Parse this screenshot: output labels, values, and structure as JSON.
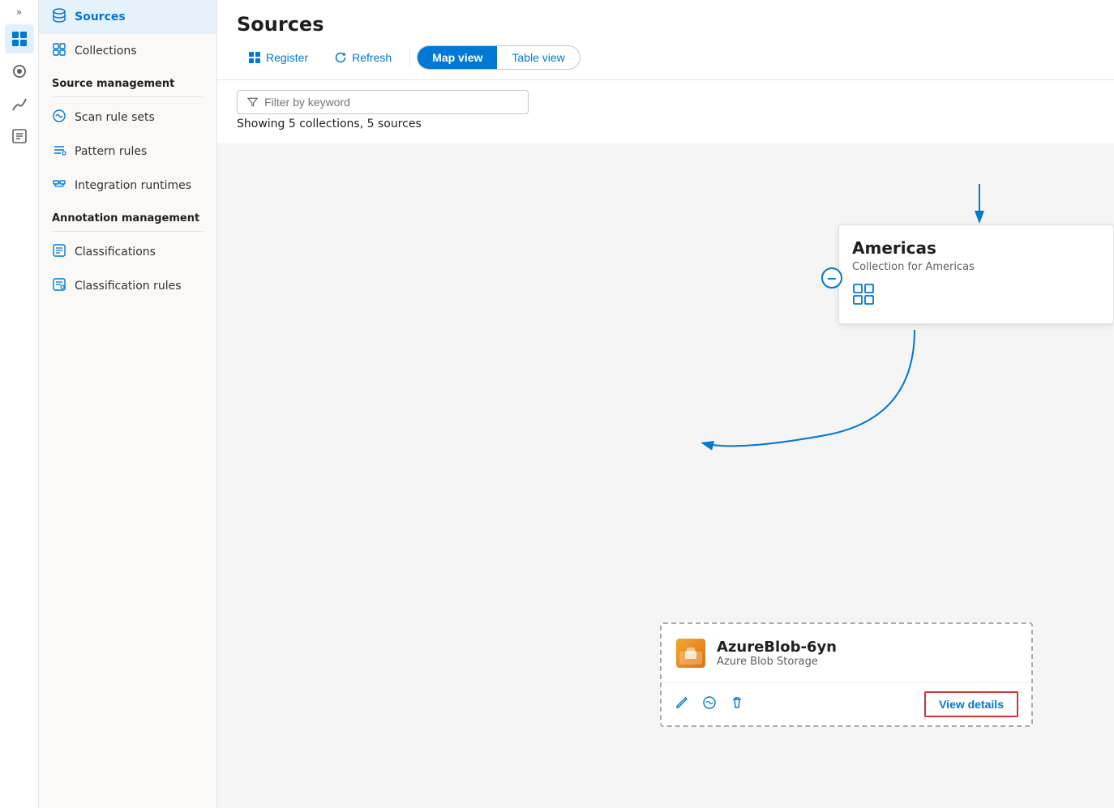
{
  "iconRail": {
    "chevron": "»",
    "icons": [
      {
        "name": "catalog-icon",
        "symbol": "🗄",
        "active": true
      },
      {
        "name": "manage-icon",
        "symbol": "⚙",
        "active": false
      },
      {
        "name": "insights-icon",
        "symbol": "📊",
        "active": false
      },
      {
        "name": "tools-icon",
        "symbol": "🧰",
        "active": false
      }
    ]
  },
  "sidebar": {
    "sourceItem": "Sources",
    "collectionsItem": "Collections",
    "sourceManagementLabel": "Source management",
    "scanRuleSets": "Scan rule sets",
    "patternRules": "Pattern rules",
    "integrationRuntimes": "Integration runtimes",
    "annotationManagementLabel": "Annotation management",
    "classifications": "Classifications",
    "classificationRules": "Classification rules"
  },
  "main": {
    "title": "Sources",
    "toolbar": {
      "registerLabel": "Register",
      "refreshLabel": "Refresh",
      "mapViewLabel": "Map view",
      "tableViewLabel": "Table view"
    },
    "filter": {
      "placeholder": "Filter by keyword"
    },
    "showingText": "Showing 5 collections, 5 sources"
  },
  "mapView": {
    "collection": {
      "title": "Americas",
      "subtitle": "Collection for Americas"
    },
    "source": {
      "name": "AzureBlob-6yn",
      "type": "Azure Blob Storage",
      "viewDetailsLabel": "View details"
    }
  }
}
